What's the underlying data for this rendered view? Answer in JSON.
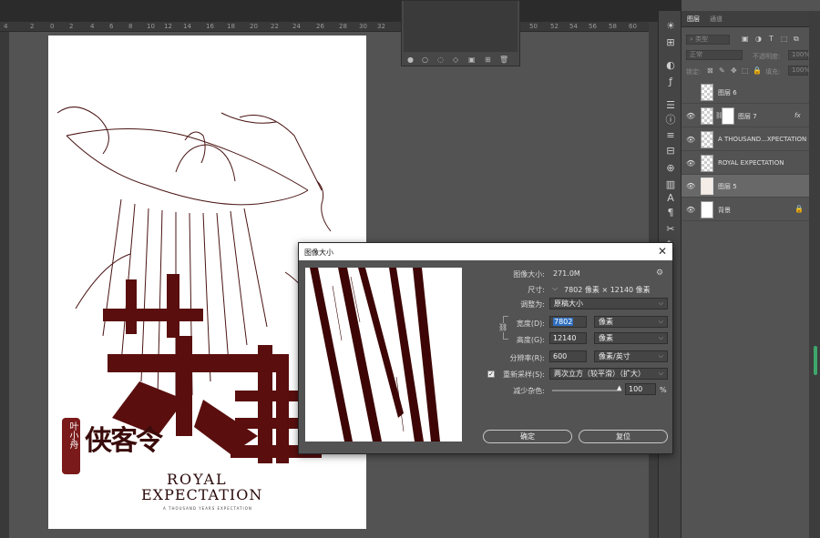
{
  "ruler": {
    "ticks": [
      "4",
      "2",
      "0",
      "2",
      "4",
      "6",
      "8",
      "10",
      "12",
      "14",
      "16",
      "18",
      "20",
      "22",
      "24",
      "26",
      "28",
      "30",
      "32",
      "50",
      "52",
      "54",
      "56",
      "58",
      "60"
    ]
  },
  "canvas": {
    "art_title_cn": "英雄",
    "art_subtitle_cn": "侠客令",
    "seal_text": "叶小舟",
    "title_line1": "ROYAL",
    "title_line2": "EXPECTATION",
    "tagline": "A THOUSAND YEARS EXPECTATION"
  },
  "layers_panel": {
    "tab_layers": "图层",
    "tab_channels": "通道",
    "filter_kind": "类型",
    "blend_mode": "正常",
    "opacity_label": "不透明度:",
    "opacity_value": "100%",
    "lock_label": "锁定:",
    "fill_label": "填充:",
    "fill_value": "100%",
    "layers": [
      {
        "name": "图层 6",
        "visible": false,
        "thumb": "transparent"
      },
      {
        "name": "图层 7",
        "visible": true,
        "thumb": "transparent",
        "fx": "fx"
      },
      {
        "name": "A THOUSAND...XPECTATION",
        "visible": true,
        "thumb": "transparent"
      },
      {
        "name": "ROYAL EXPECTATION",
        "visible": true,
        "thumb": "transparent"
      },
      {
        "name": "图层 5",
        "visible": true,
        "thumb": "art",
        "selected": true
      },
      {
        "name": "背景",
        "visible": true,
        "thumb": "white",
        "locked": true
      }
    ]
  },
  "dialog": {
    "title": "图像大小",
    "image_size_label": "图像大小:",
    "image_size_value": "271.0M",
    "dimensions_label": "尺寸:",
    "dimensions_value": "7802 像素 × 12140 像素",
    "fit_to_label": "调整为:",
    "fit_to_value": "原稿大小",
    "width_label": "宽度(D):",
    "width_value": "7802",
    "width_unit": "像素",
    "height_label": "高度(G):",
    "height_value": "12140",
    "height_unit": "像素",
    "resolution_label": "分辨率(R):",
    "resolution_value": "600",
    "resolution_unit": "像素/英寸",
    "resample_label": "重新采样(S):",
    "resample_checked": true,
    "resample_value": "两次立方（较平滑）（扩大）",
    "noise_label": "减少杂色:",
    "noise_value": "100",
    "noise_unit": "%",
    "ok_label": "确定",
    "reset_label": "复位"
  }
}
